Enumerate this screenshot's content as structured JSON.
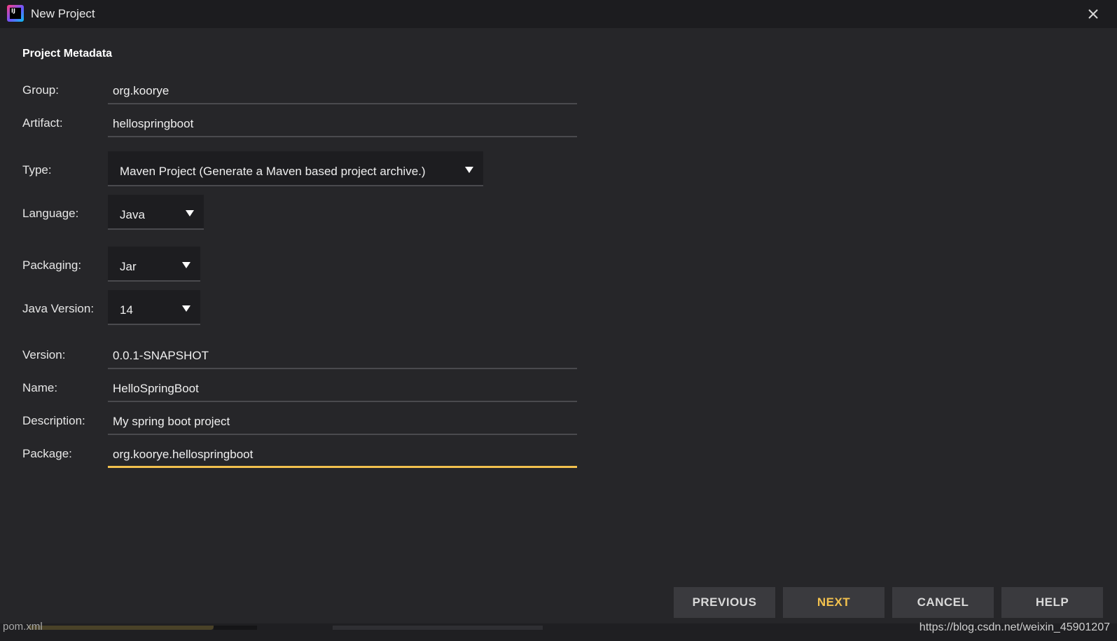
{
  "window": {
    "title": "New Project",
    "icon_text": "IJ",
    "icon": "intellij-icon",
    "close_icon": "close-icon"
  },
  "section": {
    "title": "Project Metadata"
  },
  "fields": {
    "group": {
      "label": "Group:",
      "value": "org.koorye"
    },
    "artifact": {
      "label": "Artifact:",
      "value": "hellospringboot"
    },
    "type": {
      "label": "Type:",
      "value": "Maven Project (Generate a Maven based project archive.)"
    },
    "language": {
      "label": "Language:",
      "value": "Java"
    },
    "packaging": {
      "label": "Packaging:",
      "value": "Jar"
    },
    "java_version": {
      "label": "Java Version:",
      "value": "14"
    },
    "version": {
      "label": "Version:",
      "value": "0.0.1-SNAPSHOT"
    },
    "name": {
      "label": "Name:",
      "value": "HelloSpringBoot"
    },
    "description": {
      "label": "Description:",
      "value": "My spring boot project"
    },
    "package": {
      "label": "Package:",
      "value": "org.koorye.hellospringboot"
    }
  },
  "buttons": {
    "previous": "PREVIOUS",
    "next": "NEXT",
    "cancel": "CANCEL",
    "help": "HELP"
  },
  "background": {
    "tab_file": "pom.xml",
    "watermark": "https://blog.csdn.net/weixin_45901207"
  },
  "colors": {
    "accent": "#f2c14e",
    "background": "#262629",
    "titlebar": "#1c1c1f",
    "button": "#3a3a3e"
  }
}
